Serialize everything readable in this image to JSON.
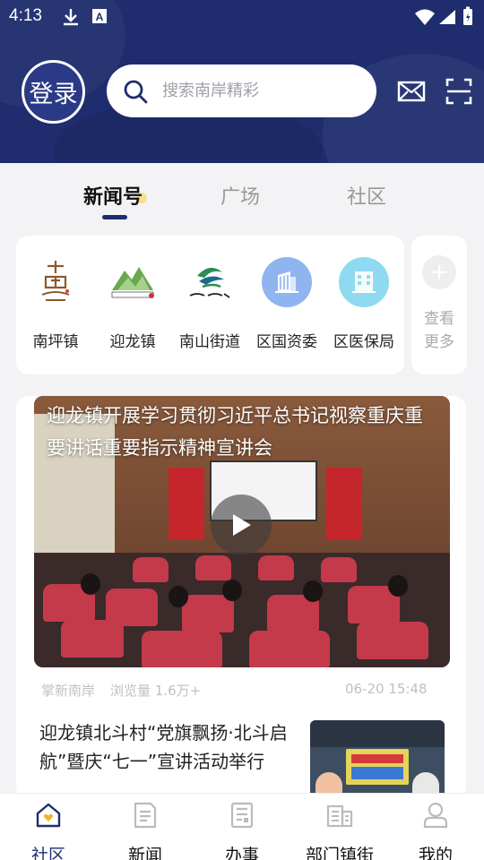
{
  "status_bar": {
    "time": "4:13"
  },
  "header": {
    "login_label": "登录",
    "search_placeholder": "搜索南岸精彩"
  },
  "tabs": [
    {
      "label": "新闻号",
      "active": true
    },
    {
      "label": "广场",
      "active": false
    },
    {
      "label": "社区",
      "active": false
    }
  ],
  "channels": [
    {
      "label": "南坪镇",
      "icon": "nanping-logo"
    },
    {
      "label": "迎龙镇",
      "icon": "yinglong-logo"
    },
    {
      "label": "南山街道",
      "icon": "nanshan-logo"
    },
    {
      "label": "区国资委",
      "icon": "building-icon"
    },
    {
      "label": "区医保局",
      "icon": "building-icon"
    }
  ],
  "more": {
    "label": "查看更多"
  },
  "feed": {
    "video": {
      "title": "迎龙镇开展学习贯彻习近平总书记视察重庆重要讲话重要指示精神宣讲会"
    },
    "meta_source": "掌新南岸",
    "meta_views": "浏览量 1.6万+",
    "meta_time": "06-20 15:48",
    "article_title": "迎龙镇北斗村“党旗飘扬·北斗启航”暨庆“七一”宣讲活动举行"
  },
  "bottom_nav": [
    {
      "label": "社区",
      "icon": "home-icon",
      "active": true
    },
    {
      "label": "新闻",
      "icon": "news-icon",
      "active": false
    },
    {
      "label": "办事",
      "icon": "service-icon",
      "active": false
    },
    {
      "label": "部门镇街",
      "icon": "department-icon",
      "active": false
    },
    {
      "label": "我的",
      "icon": "user-icon",
      "active": false
    }
  ],
  "colors": {
    "primary": "#1f2d6e",
    "accent_light": "#8fb5f0"
  }
}
